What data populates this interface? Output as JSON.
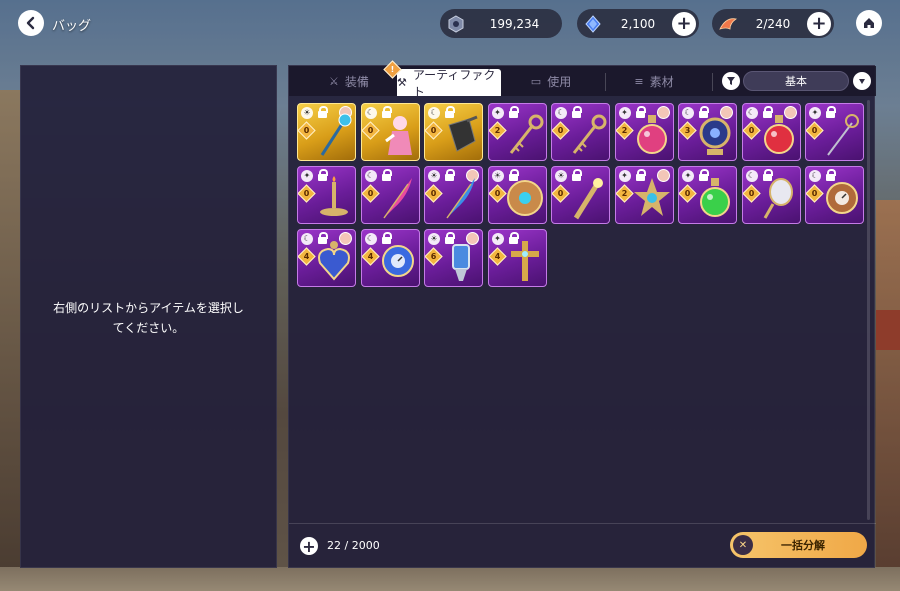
{
  "header": {
    "title": "バッグ",
    "gold": "199,234",
    "gems": "2,100",
    "stamina": "2/240"
  },
  "left_panel": {
    "message": "右側のリストからアイテムを選択してください。"
  },
  "tabs": {
    "equip": "装備",
    "artifact": "アーティファクト",
    "use": "使用",
    "material": "素材",
    "sort": "基本",
    "artifact_badge": "!"
  },
  "items": [
    {
      "rarity": "legend",
      "element": "sun",
      "level": "0",
      "color": "#3ec0e8",
      "shape": "staff",
      "chara": true
    },
    {
      "rarity": "legend",
      "element": "moon",
      "level": "0",
      "color": "#f08ab8",
      "shape": "doll",
      "chara": false
    },
    {
      "rarity": "legend",
      "element": "moon",
      "level": "0",
      "color": "#333333",
      "shape": "gauntlet",
      "chara": false
    },
    {
      "rarity": "epic",
      "element": "star",
      "level": "2",
      "color": "#d7b46a",
      "shape": "key",
      "chara": false
    },
    {
      "rarity": "epic",
      "element": "moon",
      "level": "0",
      "color": "#d7b46a",
      "shape": "key",
      "chara": false
    },
    {
      "rarity": "epic",
      "element": "star",
      "level": "2",
      "color": "#e04080",
      "shape": "potion",
      "chara": true
    },
    {
      "rarity": "epic",
      "element": "moon",
      "level": "3",
      "color": "#2a3a8a",
      "shape": "orb",
      "chara": true
    },
    {
      "rarity": "epic",
      "element": "moon",
      "level": "0",
      "color": "#e03040",
      "shape": "potion",
      "chara": true
    },
    {
      "rarity": "epic",
      "element": "star",
      "level": "0",
      "color": "#c0c0d0",
      "shape": "wand",
      "chara": false
    },
    {
      "rarity": "epic",
      "element": "star",
      "level": "0",
      "color": "#d7b46a",
      "shape": "candle",
      "chara": false
    },
    {
      "rarity": "epic",
      "element": "moon",
      "level": "0",
      "color": "#e84aa0",
      "shape": "feather",
      "chara": false
    },
    {
      "rarity": "epic",
      "element": "sun",
      "level": "0",
      "color": "#3a8ee8",
      "shape": "feather",
      "chara": true
    },
    {
      "rarity": "epic",
      "element": "sun",
      "level": "0",
      "color": "#c98a4a",
      "shape": "shield",
      "chara": false
    },
    {
      "rarity": "epic",
      "element": "sun",
      "level": "0",
      "color": "#d7b46a",
      "shape": "scepter",
      "chara": false
    },
    {
      "rarity": "epic",
      "element": "star",
      "level": "2",
      "color": "#3ac0e8",
      "shape": "star",
      "chara": true
    },
    {
      "rarity": "epic",
      "element": "star",
      "level": "0",
      "color": "#3ad04a",
      "shape": "potion",
      "chara": false
    },
    {
      "rarity": "epic",
      "element": "moon",
      "level": "0",
      "color": "#e8e8f0",
      "shape": "mirror",
      "chara": false
    },
    {
      "rarity": "epic",
      "element": "moon",
      "level": "0",
      "color": "#b06a3a",
      "shape": "clock",
      "chara": false
    },
    {
      "rarity": "epic",
      "element": "moon",
      "level": "4",
      "color": "#3a5ad0",
      "shape": "heart",
      "chara": true
    },
    {
      "rarity": "epic",
      "element": "moon",
      "level": "4",
      "color": "#3a6ae0",
      "shape": "clock",
      "chara": false
    },
    {
      "rarity": "epic",
      "element": "sun",
      "level": "6",
      "color": "#4a8ae0",
      "shape": "lamp",
      "chara": true
    },
    {
      "rarity": "epic",
      "element": "star",
      "level": "4",
      "color": "#d7a84a",
      "shape": "cross",
      "chara": false
    }
  ],
  "footer": {
    "count": "22 / 2000",
    "dismantle_label": "一括分解"
  },
  "colors": {
    "panel": "#23203a",
    "epic": "#8a2bbf",
    "legend": "#e6b22c",
    "accent": "#f2b24f"
  }
}
